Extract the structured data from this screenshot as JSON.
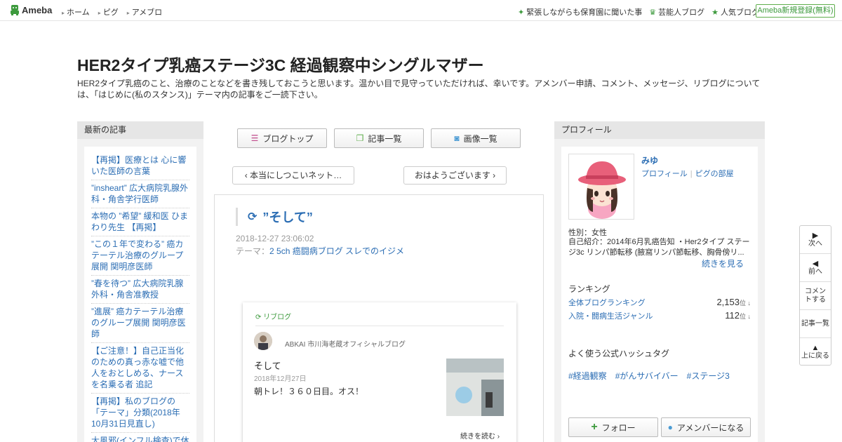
{
  "header": {
    "logo": "Ameba",
    "nav": [
      "ホーム",
      "ピグ",
      "アメブロ"
    ],
    "right_links": [
      {
        "icon": "sparkle-icon",
        "label": "緊張しながらも保育園に聞いた事"
      },
      {
        "icon": "crown-icon",
        "label": "芸能人ブログ"
      },
      {
        "icon": "star-icon",
        "label": "人気ブログ"
      }
    ],
    "register_label": "Ameba新規登録(無料)",
    "accent_color": "#3d9a3d"
  },
  "blog": {
    "title": "HER2タイプ乳癌ステージ3C 経過観察中シングルマザー",
    "description": "HER2タイプ乳癌のこと、治療のことなどを書き残しておこうと思います。温かい目で見守っていただければ、幸いです。アメンバー申請、コメント、メッセージ、リブログについては、「はじめに(私のスタンス)」テーマ内の記事をご一読下さい。"
  },
  "left": {
    "heading": "最新の記事",
    "recent": [
      "【再掲】医療とは 心に響いた医師の言葉",
      "”insheart” 広大病院乳腺外科・角舎学行医師",
      "本物の ”希望” 緩和医 ひまわり先生 【再掲】",
      "”この１年で変わる” 癌カテーテル治療のグループ展開 関明彦医師",
      "”春を待つ” 広大病院乳腺外科・角舎准教授",
      "”進展” 癌カテーテル治療のグループ展開 関明彦医師",
      "【ご注意！】自己正当化のための真っ赤な嘘で他人をおとしめる、ナースを名乗る者 追記",
      "【再掲】私のブログの「テーマ」分類(2018年10月31日見直し)",
      "大風邪(インフル検査)で休"
    ]
  },
  "center": {
    "buttons": [
      {
        "icon": "document-icon",
        "label": "ブログトップ"
      },
      {
        "icon": "copy-icon",
        "label": "記事一覧"
      },
      {
        "icon": "camera-icon",
        "label": "画像一覧"
      }
    ],
    "prev_label": "‹ 本当にしつこいネット…",
    "next_label": "おはようございます ›",
    "entry": {
      "title": "”そして”",
      "date": "2018-12-27 23:06:02",
      "theme_prefix": "テーマ：",
      "theme": "2 5ch 癌闘病ブログ スレでのイジメ"
    },
    "reblog": {
      "label": "リブログ",
      "blog_name": "ABKAI 市川海老蔵オフィシャルブログ",
      "title": "そして",
      "date": "2018年12月27日",
      "text": "朝トレ！３６０日目。オス！",
      "more": "続きを読む ›"
    }
  },
  "right": {
    "heading": "プロフィール",
    "name": "みゆ",
    "link_profile": "プロフィール",
    "link_pig": "ピグの部屋",
    "gender": "性別：女性",
    "intro": "自己紹介：2014年6月乳癌告知 ・Her2タイプ ステージ3c リンパ節転移 (腋窩リンパ節転移、胸骨傍リ...",
    "more": "続きを見る",
    "ranking_heading": "ランキング",
    "ranking": [
      {
        "label": "全体ブログランキング",
        "value": "2,153",
        "unit": "位 ↓"
      },
      {
        "label": "入院・闘病生活ジャンル",
        "value": "112",
        "unit": "位 ↓"
      }
    ],
    "hashtag_heading": "よく使う公式ハッシュタグ",
    "hashtags": [
      "#経過観察",
      "#がんサバイバー",
      "#ステージ3"
    ],
    "follow_label": "フォロー",
    "amember_label": "アメンバーになる"
  },
  "floatnav": [
    {
      "icon": "next-icon",
      "glyph": "▶",
      "label": "次へ"
    },
    {
      "icon": "prev-icon",
      "glyph": "◀",
      "label": "前へ"
    },
    {
      "icon": "",
      "glyph": "",
      "label": "コメントする"
    },
    {
      "icon": "",
      "glyph": "",
      "label": "記事一覧"
    },
    {
      "icon": "up-icon",
      "glyph": "▲",
      "label": "上に戻る"
    }
  ]
}
